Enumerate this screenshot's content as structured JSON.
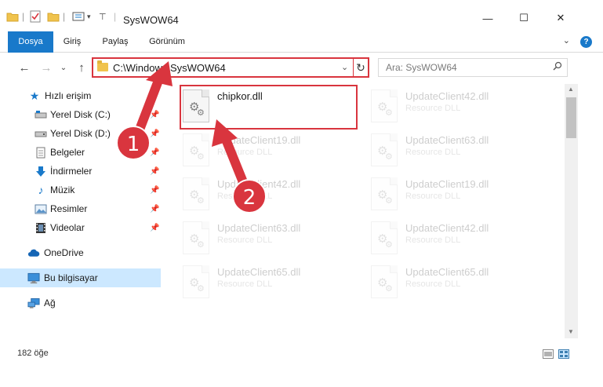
{
  "window": {
    "title": "SysWOW64",
    "minimize": "—",
    "maximize": "☐",
    "close": "✕"
  },
  "ribbon": {
    "tabs": [
      "Dosya",
      "Giriş",
      "Paylaş",
      "Görünüm"
    ],
    "active_tab": "Dosya",
    "help": "?"
  },
  "nav": {
    "back": "←",
    "forward": "→",
    "recent": "⌄",
    "up": "↑",
    "address": "C:\\Windows\\SysWOW64",
    "refresh": "↻",
    "search_placeholder": "Ara: SysWOW64"
  },
  "sidebar": {
    "quick_access": "Hızlı erişim",
    "items": [
      {
        "label": "Yerel Disk (C:)",
        "pinned": true
      },
      {
        "label": "Yerel Disk (D:)",
        "pinned": true
      },
      {
        "label": "Belgeler",
        "pinned": true
      },
      {
        "label": "İndirmeler",
        "pinned": true
      },
      {
        "label": "Müzik",
        "pinned": true
      },
      {
        "label": "Resimler",
        "pinned": true
      },
      {
        "label": "Videolar",
        "pinned": true
      }
    ],
    "onedrive": "OneDrive",
    "this_pc": "Bu bilgisayar",
    "network": "Ağ"
  },
  "files": [
    {
      "name": "chipkor.dll",
      "type": "",
      "col": 0,
      "row": 0,
      "faded": false
    },
    {
      "name": "UpdateClient42.dll",
      "type": "Resource DLL",
      "col": 1,
      "row": 0,
      "faded": true
    },
    {
      "name": "UpdateClient19.dll",
      "type": "Resource DLL",
      "col": 0,
      "row": 1,
      "faded": true
    },
    {
      "name": "UpdateClient63.dll",
      "type": "Resource DLL",
      "col": 1,
      "row": 1,
      "faded": true
    },
    {
      "name": "UpdateClient42.dll",
      "type": "Resource DLL",
      "col": 0,
      "row": 2,
      "faded": true
    },
    {
      "name": "UpdateClient19.dll",
      "type": "Resource DLL",
      "col": 1,
      "row": 2,
      "faded": true
    },
    {
      "name": "UpdateClient63.dll",
      "type": "Resource DLL",
      "col": 0,
      "row": 3,
      "faded": true
    },
    {
      "name": "UpdateClient42.dll",
      "type": "Resource DLL",
      "col": 1,
      "row": 3,
      "faded": true
    },
    {
      "name": "UpdateClient65.dll",
      "type": "Resource DLL",
      "col": 0,
      "row": 4,
      "faded": true
    },
    {
      "name": "UpdateClient65.dll",
      "type": "Resource DLL",
      "col": 1,
      "row": 4,
      "faded": true
    }
  ],
  "status": {
    "count": "182 öğe"
  },
  "annotations": {
    "step1": "1",
    "step2": "2",
    "color": "#d9353e"
  },
  "colors": {
    "accent": "#1979ca",
    "selected": "#cce8ff"
  }
}
